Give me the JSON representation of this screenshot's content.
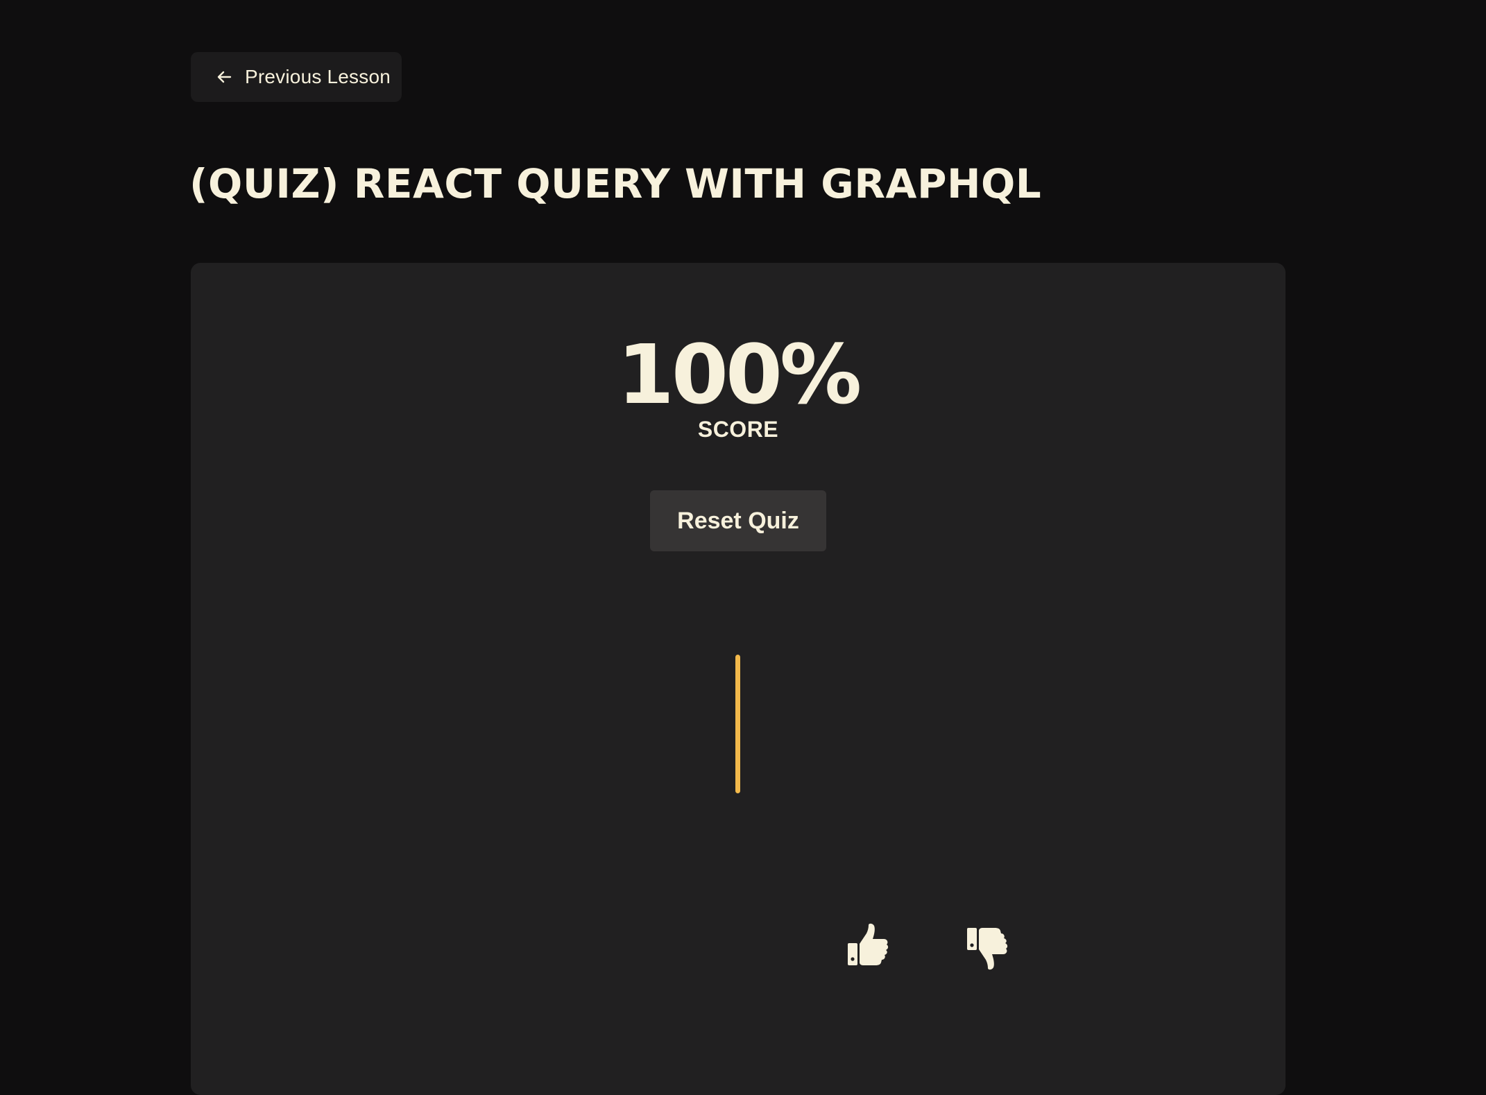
{
  "nav": {
    "previous_label": "Previous Lesson"
  },
  "lesson": {
    "title": "(QUIZ) REACT QUERY WITH GRAPHQL"
  },
  "result": {
    "score": "100%",
    "score_label": "SCORE",
    "reset_label": "Reset Quiz"
  },
  "feedback": {
    "like_icon": "thumbs-up-icon",
    "dislike_icon": "thumbs-down-icon"
  },
  "colors": {
    "page_bg": "#0f0e0f",
    "card_bg": "#212021",
    "text": "#f7f1dc",
    "accent": "#f3b94b",
    "button_bg": "#363434"
  }
}
